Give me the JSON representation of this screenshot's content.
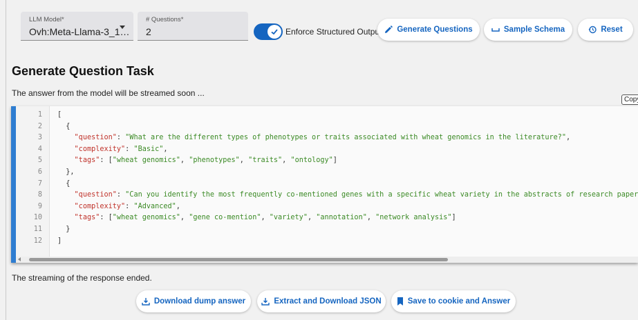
{
  "toolbar": {
    "model_label": "LLM Model*",
    "model_value": "Ovh:Meta-Llama-3_1…",
    "questions_label": "# Questions*",
    "questions_value": "2",
    "enforce_label": "Enforce Structured Output",
    "enforce_checked": true,
    "generate_label": "Generate Questions",
    "schema_label": "Sample Schema",
    "reset_label": "Reset"
  },
  "main": {
    "heading": "Generate Question Task",
    "stream_note": "The answer from the model will be streamed soon ...",
    "copy_label": "Copy",
    "ended_note": "The streaming of the response ended."
  },
  "code": {
    "line_numbers": [
      "1",
      "2",
      "3",
      "4",
      "5",
      "6",
      "7",
      "8",
      "9",
      "10",
      "11",
      "12"
    ],
    "lines": [
      "[",
      "  {",
      "    \"question\": \"What are the different types of phenotypes or traits associated with wheat genomics in the literature?\",",
      "    \"complexity\": \"Basic\",",
      "    \"tags\": [\"wheat genomics\", \"phenotypes\", \"traits\", \"ontology\"]",
      "  },",
      "  {",
      "    \"question\": \"Can you identify the most frequently co-mentioned genes with a specific wheat variety in the abstracts of research papers a",
      "    \"complexity\": \"Advanced\",",
      "    \"tags\": [\"wheat genomics\", \"gene co-mention\", \"variety\", \"annotation\", \"network analysis\"]",
      "  }",
      "]"
    ]
  },
  "actions": {
    "dump_label": "Download dump answer",
    "extract_label": "Extract and Download JSON",
    "save_label": "Save to cookie and Answer"
  },
  "colors": {
    "accent": "#1565c0",
    "json_key": "#c0332b",
    "json_string": "#3b8a25",
    "code_bar": "#2e7dd1"
  }
}
